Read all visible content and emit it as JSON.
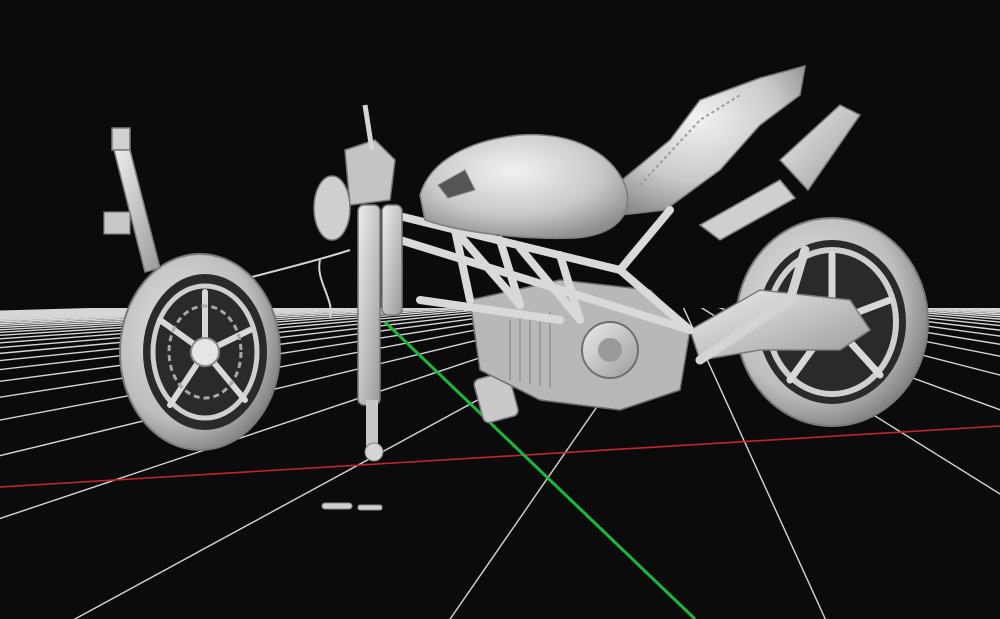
{
  "viewport": {
    "background": "#0b0b0b",
    "grid_color": "#d6d6d6",
    "x_axis_color": "#c0272d",
    "y_axis_color": "#19b93a",
    "model_color": "#cfcfcf",
    "model_shadow": "#8e8e8e",
    "model_highlight": "#f0f0f0"
  },
  "scene": {
    "object": "motorcycle-3d-scan",
    "parts": [
      "front-wheel",
      "front-fork",
      "fuel-tank",
      "seat",
      "exhaust",
      "trellis-frame",
      "engine",
      "rear-wheel",
      "swingarm"
    ]
  }
}
